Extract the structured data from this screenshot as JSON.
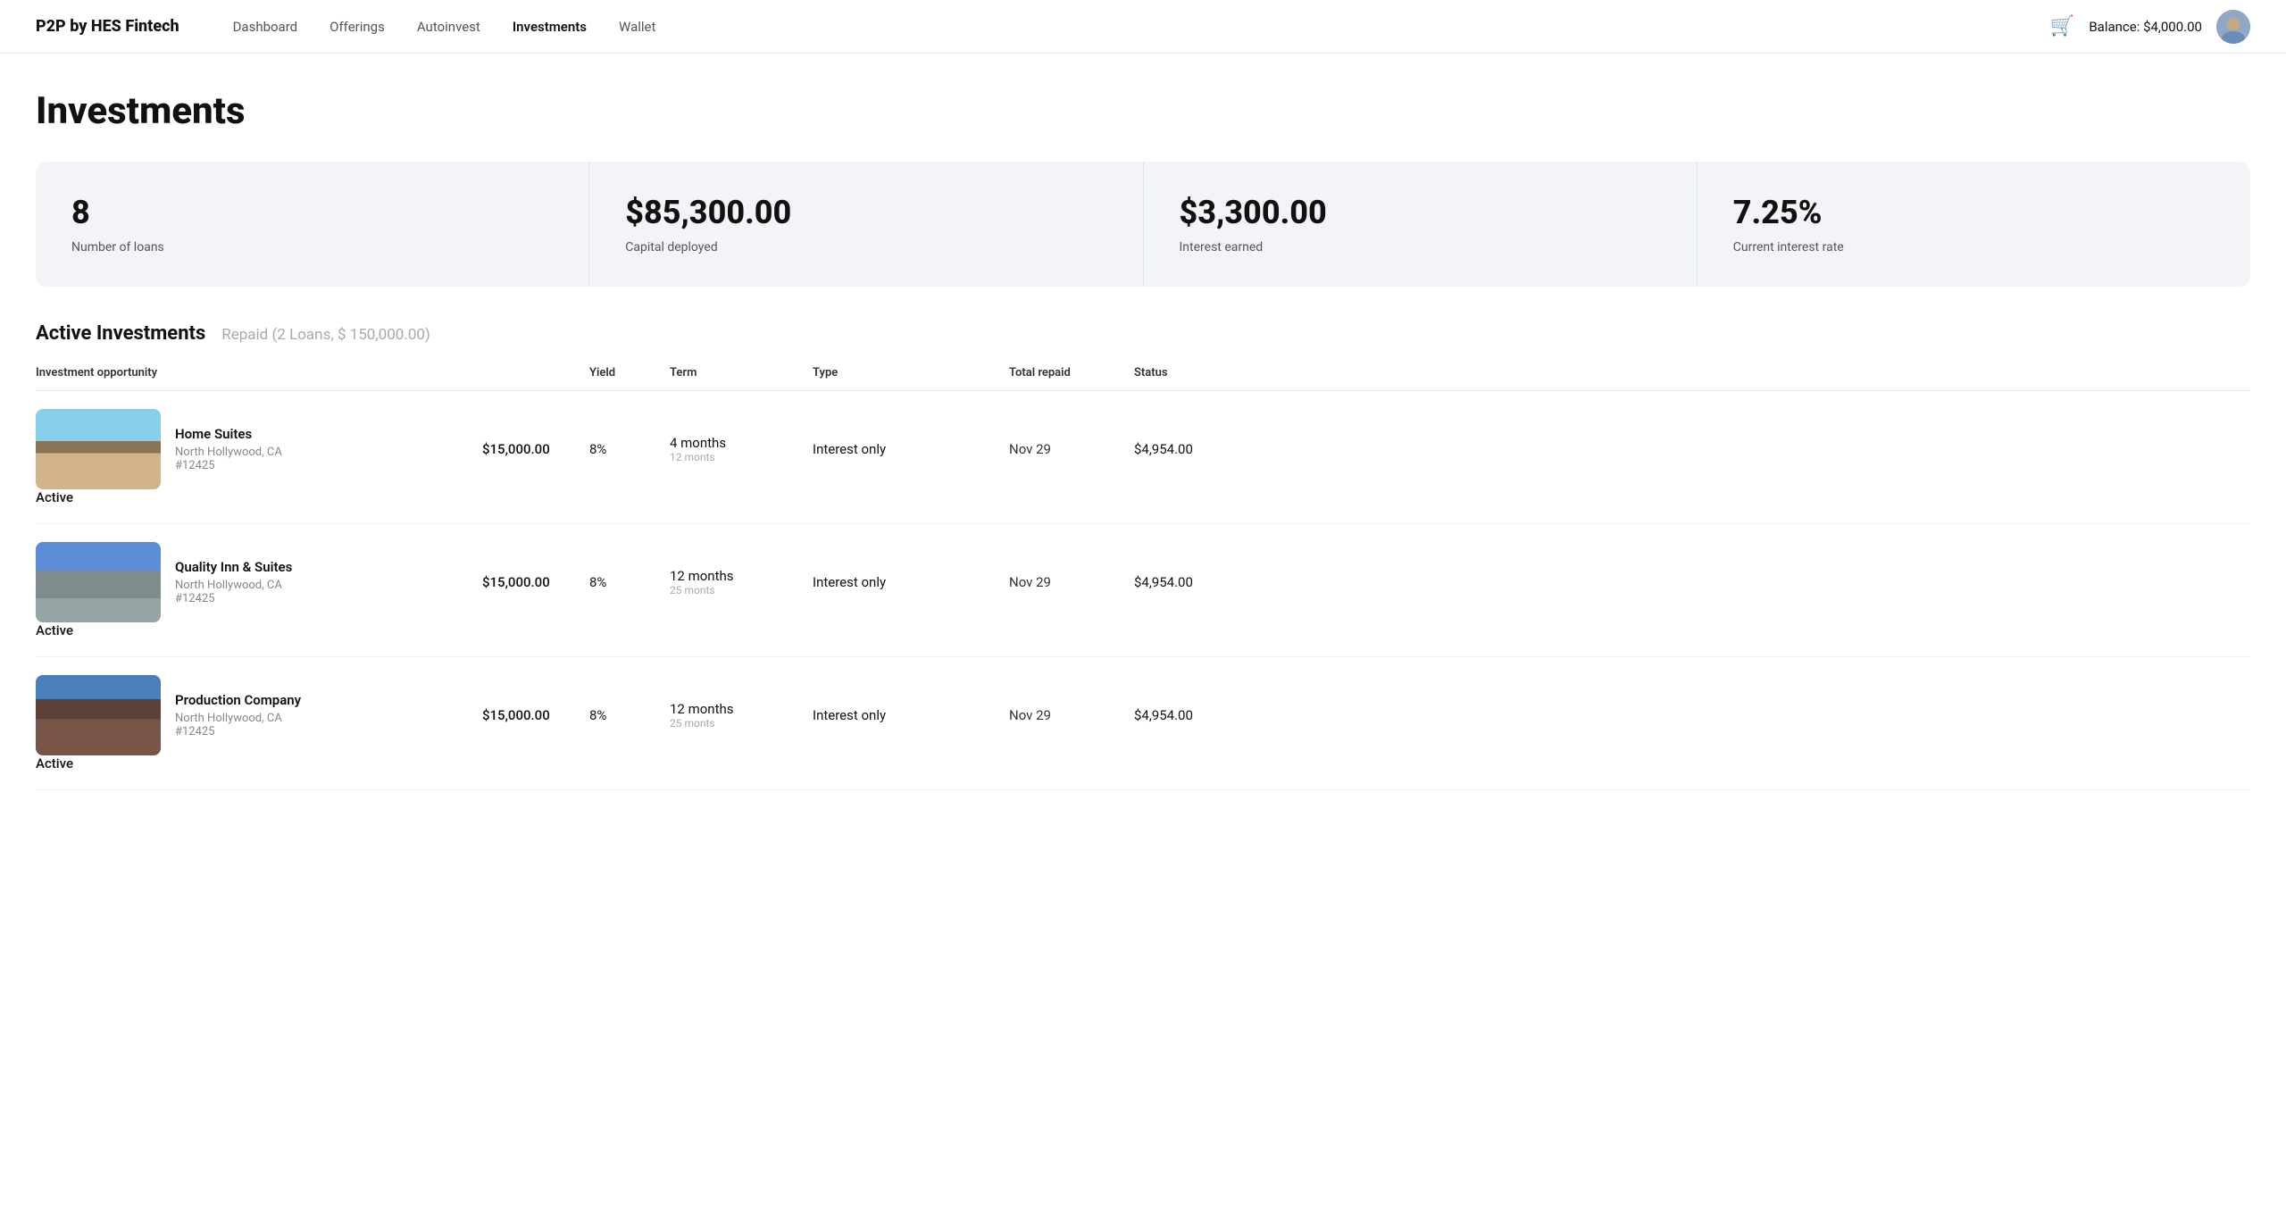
{
  "brand": "P2P by HES Fintech",
  "nav": {
    "links": [
      {
        "label": "Dashboard",
        "active": false
      },
      {
        "label": "Offerings",
        "active": false
      },
      {
        "label": "Autoinvest",
        "active": false
      },
      {
        "label": "Investments",
        "active": true
      },
      {
        "label": "Wallet",
        "active": false
      }
    ],
    "balance": "Balance: $4,000.00"
  },
  "page": {
    "title": "Investments"
  },
  "stats": [
    {
      "value": "8",
      "label": "Number of loans"
    },
    {
      "value": "$85,300.00",
      "label": "Capital deployed"
    },
    {
      "value": "$3,300.00",
      "label": "Interest earned"
    },
    {
      "value": "7.25%",
      "label": "Current interest rate"
    }
  ],
  "section": {
    "active_title": "Active Investments",
    "repaid_subtitle": "Repaid (2 Loans, $ 150,000.00)"
  },
  "table": {
    "headers": [
      "Investment opportunity",
      "",
      "Yield",
      "Term",
      "Type",
      "Total repaid",
      "Status"
    ],
    "rows": [
      {
        "name": "Home Suites",
        "location": "North Hollywood, CA",
        "id": "#12425",
        "amount": "$15,000.00",
        "yield": "8%",
        "term_main": "4 months",
        "term_sub": "12 monts",
        "type": "Interest only",
        "date": "Nov 29",
        "total_repaid": "$4,954.00",
        "status": "Active",
        "img_class": "img-placeholder-1"
      },
      {
        "name": "Quality Inn & Suites",
        "location": "North Hollywood, CA",
        "id": "#12425",
        "amount": "$15,000.00",
        "yield": "8%",
        "term_main": "12 months",
        "term_sub": "25 monts",
        "type": "Interest only",
        "date": "Nov 29",
        "total_repaid": "$4,954.00",
        "status": "Active",
        "img_class": "img-placeholder-2"
      },
      {
        "name": "Production Company",
        "location": "North Hollywood, CA",
        "id": "#12425",
        "amount": "$15,000.00",
        "yield": "8%",
        "term_main": "12 months",
        "term_sub": "25 monts",
        "type": "Interest only",
        "date": "Nov 29",
        "total_repaid": "$4,954.00",
        "status": "Active",
        "img_class": "img-placeholder-3"
      }
    ]
  }
}
